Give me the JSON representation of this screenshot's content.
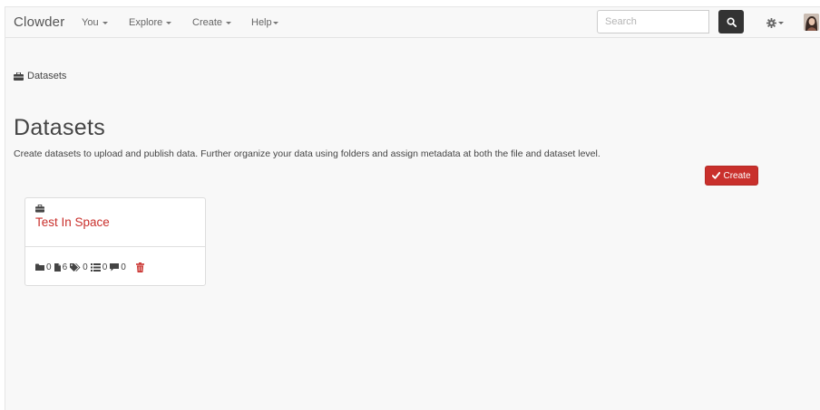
{
  "navbar": {
    "brand": "Clowder",
    "menus": [
      {
        "label": "You"
      },
      {
        "label": "Explore"
      },
      {
        "label": "Create"
      },
      {
        "label": "Help"
      }
    ],
    "search_placeholder": "Search"
  },
  "breadcrumb": {
    "label": "Datasets"
  },
  "page": {
    "title": "Datasets",
    "description": "Create datasets to upload and publish data. Further organize your data using folders and assign metadata at both the file and dataset level.",
    "create_label": "Create"
  },
  "datasets": [
    {
      "title": "Test In Space",
      "stats": {
        "folders": "0",
        "files": "6",
        "tags": "0",
        "metadata": "0",
        "comments": "0"
      }
    }
  ],
  "icons": {
    "folder": "folder-icon",
    "file": "file-icon",
    "tag": "tags-icon",
    "metadata": "list-icon",
    "comment": "comment-icon",
    "delete": "trash-icon",
    "dataset": "briefcase-icon",
    "search": "search-icon",
    "settings": "gear-icon",
    "check": "check-icon"
  },
  "colors": {
    "accent": "#c9302c",
    "background": "#f8f8f8",
    "text": "#444444"
  }
}
